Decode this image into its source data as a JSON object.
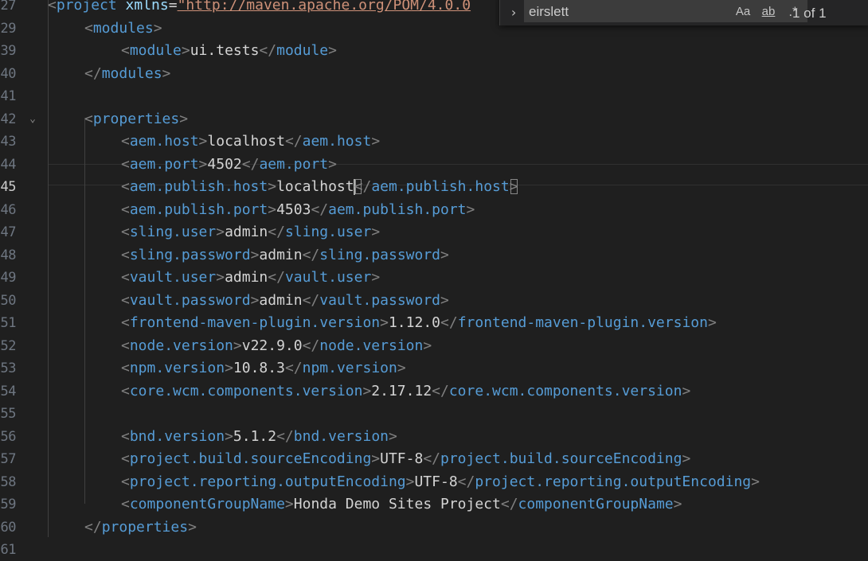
{
  "editor": {
    "current_line": 45,
    "lines": [
      {
        "num": "27",
        "tokens": [
          [
            "bracket",
            "<"
          ],
          [
            "tag",
            "project"
          ],
          [
            "txt",
            " "
          ],
          [
            "attr",
            "xmlns"
          ],
          [
            "txt",
            "="
          ],
          [
            "url",
            "\"http://maven.apache.org/POM/4.0.0"
          ]
        ]
      },
      {
        "num": "29",
        "tokens": [
          [
            "bracket",
            "<"
          ],
          [
            "tag",
            "modules"
          ],
          [
            "bracket",
            ">"
          ]
        ]
      },
      {
        "num": "39",
        "tokens": [
          [
            "bracket",
            "<"
          ],
          [
            "tag",
            "module"
          ],
          [
            "bracket",
            ">"
          ],
          [
            "txt",
            "ui.tests"
          ],
          [
            "bracket",
            "</"
          ],
          [
            "tag",
            "module"
          ],
          [
            "bracket",
            ">"
          ]
        ]
      },
      {
        "num": "40",
        "tokens": [
          [
            "bracket",
            "</"
          ],
          [
            "tag",
            "modules"
          ],
          [
            "bracket",
            ">"
          ]
        ]
      },
      {
        "num": "41",
        "tokens": []
      },
      {
        "num": "42",
        "fold": true,
        "tokens": [
          [
            "bracket",
            "<"
          ],
          [
            "tag",
            "properties"
          ],
          [
            "bracket",
            ">"
          ]
        ]
      },
      {
        "num": "43",
        "tokens": [
          [
            "bracket",
            "<"
          ],
          [
            "tag",
            "aem.host"
          ],
          [
            "bracket",
            ">"
          ],
          [
            "txt",
            "localhost"
          ],
          [
            "bracket",
            "</"
          ],
          [
            "tag",
            "aem.host"
          ],
          [
            "bracket",
            ">"
          ]
        ]
      },
      {
        "num": "44",
        "tokens": [
          [
            "bracket",
            "<"
          ],
          [
            "tag",
            "aem.port"
          ],
          [
            "bracket",
            ">"
          ],
          [
            "txt",
            "4502"
          ],
          [
            "bracket",
            "</"
          ],
          [
            "tag",
            "aem.port"
          ],
          [
            "bracket",
            ">"
          ]
        ]
      },
      {
        "num": "45",
        "tokens": [
          [
            "bracket",
            "<"
          ],
          [
            "tag",
            "aem.publish.host"
          ],
          [
            "bracket",
            ">"
          ],
          [
            "txt",
            "localhost"
          ],
          [
            "cursor",
            ""
          ],
          [
            "matchbracket",
            "<"
          ],
          [
            "bracket",
            "/"
          ],
          [
            "tag",
            "aem.publish.host"
          ],
          [
            "matchbracket",
            ">"
          ]
        ]
      },
      {
        "num": "46",
        "tokens": [
          [
            "bracket",
            "<"
          ],
          [
            "tag",
            "aem.publish.port"
          ],
          [
            "bracket",
            ">"
          ],
          [
            "txt",
            "4503"
          ],
          [
            "bracket",
            "</"
          ],
          [
            "tag",
            "aem.publish.port"
          ],
          [
            "bracket",
            ">"
          ]
        ]
      },
      {
        "num": "47",
        "tokens": [
          [
            "bracket",
            "<"
          ],
          [
            "tag",
            "sling.user"
          ],
          [
            "bracket",
            ">"
          ],
          [
            "txt",
            "admin"
          ],
          [
            "bracket",
            "</"
          ],
          [
            "tag",
            "sling.user"
          ],
          [
            "bracket",
            ">"
          ]
        ]
      },
      {
        "num": "48",
        "tokens": [
          [
            "bracket",
            "<"
          ],
          [
            "tag",
            "sling.password"
          ],
          [
            "bracket",
            ">"
          ],
          [
            "txt",
            "admin"
          ],
          [
            "bracket",
            "</"
          ],
          [
            "tag",
            "sling.password"
          ],
          [
            "bracket",
            ">"
          ]
        ]
      },
      {
        "num": "49",
        "tokens": [
          [
            "bracket",
            "<"
          ],
          [
            "tag",
            "vault.user"
          ],
          [
            "bracket",
            ">"
          ],
          [
            "txt",
            "admin"
          ],
          [
            "bracket",
            "</"
          ],
          [
            "tag",
            "vault.user"
          ],
          [
            "bracket",
            ">"
          ]
        ]
      },
      {
        "num": "50",
        "tokens": [
          [
            "bracket",
            "<"
          ],
          [
            "tag",
            "vault.password"
          ],
          [
            "bracket",
            ">"
          ],
          [
            "txt",
            "admin"
          ],
          [
            "bracket",
            "</"
          ],
          [
            "tag",
            "vault.password"
          ],
          [
            "bracket",
            ">"
          ]
        ]
      },
      {
        "num": "51",
        "tokens": [
          [
            "bracket",
            "<"
          ],
          [
            "tag",
            "frontend-maven-plugin.version"
          ],
          [
            "bracket",
            ">"
          ],
          [
            "txt",
            "1.12.0"
          ],
          [
            "bracket",
            "</"
          ],
          [
            "tag",
            "frontend-maven-plugin.version"
          ],
          [
            "bracket",
            ">"
          ]
        ]
      },
      {
        "num": "52",
        "tokens": [
          [
            "bracket",
            "<"
          ],
          [
            "tag",
            "node.version"
          ],
          [
            "bracket",
            ">"
          ],
          [
            "txt",
            "v22.9.0"
          ],
          [
            "bracket",
            "</"
          ],
          [
            "tag",
            "node.version"
          ],
          [
            "bracket",
            ">"
          ]
        ]
      },
      {
        "num": "53",
        "tokens": [
          [
            "bracket",
            "<"
          ],
          [
            "tag",
            "npm.version"
          ],
          [
            "bracket",
            ">"
          ],
          [
            "txt",
            "10.8.3"
          ],
          [
            "bracket",
            "</"
          ],
          [
            "tag",
            "npm.version"
          ],
          [
            "bracket",
            ">"
          ]
        ]
      },
      {
        "num": "54",
        "tokens": [
          [
            "bracket",
            "<"
          ],
          [
            "tag",
            "core.wcm.components.version"
          ],
          [
            "bracket",
            ">"
          ],
          [
            "txt",
            "2.17.12"
          ],
          [
            "bracket",
            "</"
          ],
          [
            "tag",
            "core.wcm.components.version"
          ],
          [
            "bracket",
            ">"
          ]
        ]
      },
      {
        "num": "55",
        "tokens": []
      },
      {
        "num": "56",
        "tokens": [
          [
            "bracket",
            "<"
          ],
          [
            "tag",
            "bnd.version"
          ],
          [
            "bracket",
            ">"
          ],
          [
            "txt",
            "5.1.2"
          ],
          [
            "bracket",
            "</"
          ],
          [
            "tag",
            "bnd.version"
          ],
          [
            "bracket",
            ">"
          ]
        ]
      },
      {
        "num": "57",
        "tokens": [
          [
            "bracket",
            "<"
          ],
          [
            "tag",
            "project.build.sourceEncoding"
          ],
          [
            "bracket",
            ">"
          ],
          [
            "txt",
            "UTF-8"
          ],
          [
            "bracket",
            "</"
          ],
          [
            "tag",
            "project.build.sourceEncoding"
          ],
          [
            "bracket",
            ">"
          ]
        ]
      },
      {
        "num": "58",
        "tokens": [
          [
            "bracket",
            "<"
          ],
          [
            "tag",
            "project.reporting.outputEncoding"
          ],
          [
            "bracket",
            ">"
          ],
          [
            "txt",
            "UTF-8"
          ],
          [
            "bracket",
            "</"
          ],
          [
            "tag",
            "project.reporting.outputEncoding"
          ],
          [
            "bracket",
            ">"
          ]
        ]
      },
      {
        "num": "59",
        "tokens": [
          [
            "bracket",
            "<"
          ],
          [
            "tag",
            "componentGroupName"
          ],
          [
            "bracket",
            ">"
          ],
          [
            "txt",
            "Honda Demo Sites Project"
          ],
          [
            "bracket",
            "</"
          ],
          [
            "tag",
            "componentGroupName"
          ],
          [
            "bracket",
            ">"
          ]
        ]
      },
      {
        "num": "60",
        "tokens": [
          [
            "bracket",
            "</"
          ],
          [
            "tag",
            "properties"
          ],
          [
            "bracket",
            ">"
          ]
        ]
      },
      {
        "num": "61",
        "tokens": []
      }
    ]
  },
  "find_widget": {
    "query": "eirslett",
    "toggle_icon": "chevron-right-icon",
    "match_case_label": "Aa",
    "whole_word_label": "ab",
    "regex_label": ".*",
    "result_count": "1 of 1"
  }
}
